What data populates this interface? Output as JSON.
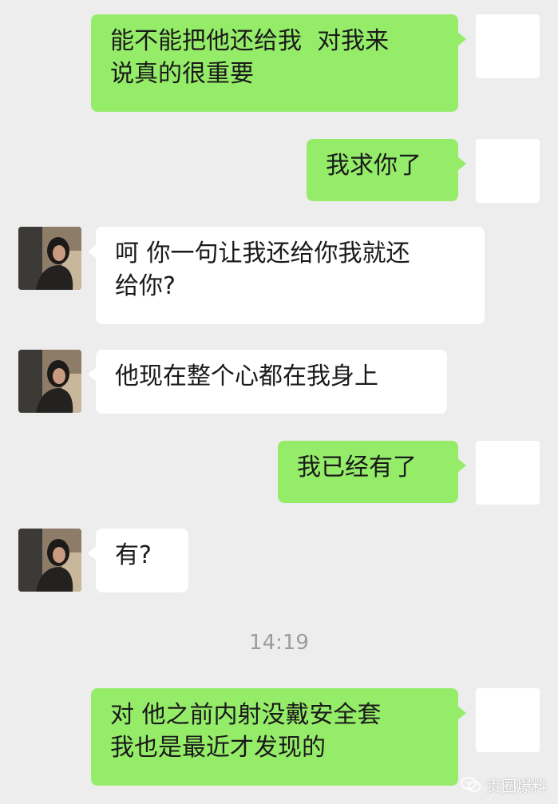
{
  "chat": {
    "messages": [
      {
        "side": "me",
        "text": "能不能把他还给我  对我来\n说真的很重要"
      },
      {
        "side": "me",
        "text": "我求你了"
      },
      {
        "side": "them",
        "text": "呵 你一句让我还给你我就还\n给你?"
      },
      {
        "side": "them",
        "text": "他现在整个心都在我身上"
      },
      {
        "side": "me",
        "text": "我已经有了"
      },
      {
        "side": "them",
        "text": "有?"
      },
      {
        "side": "me",
        "text": "对 他之前内射没戴安全套\n我也是最近才发现的"
      }
    ],
    "timestamp": "14:19"
  },
  "watermark": {
    "text": "贵圈爆料",
    "icon": "chat-bubbles-icon"
  },
  "colors": {
    "background": "#ededed",
    "me_bubble": "#95ec69",
    "them_bubble": "#ffffff",
    "timestamp_text": "#9c9c9c"
  }
}
